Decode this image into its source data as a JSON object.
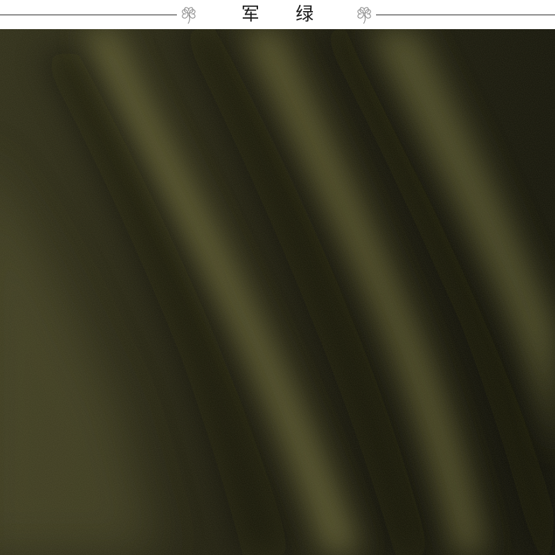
{
  "header": {
    "title": "军 绿"
  },
  "colors": {
    "fabric_base": "#1a1a0c",
    "fabric_highlight": "#6b6a3a",
    "rule_line": "#2b2b2b"
  },
  "icons": {
    "left": "clover-icon",
    "right": "clover-icon"
  },
  "image": {
    "subject": "fabric-swatch-photo"
  }
}
